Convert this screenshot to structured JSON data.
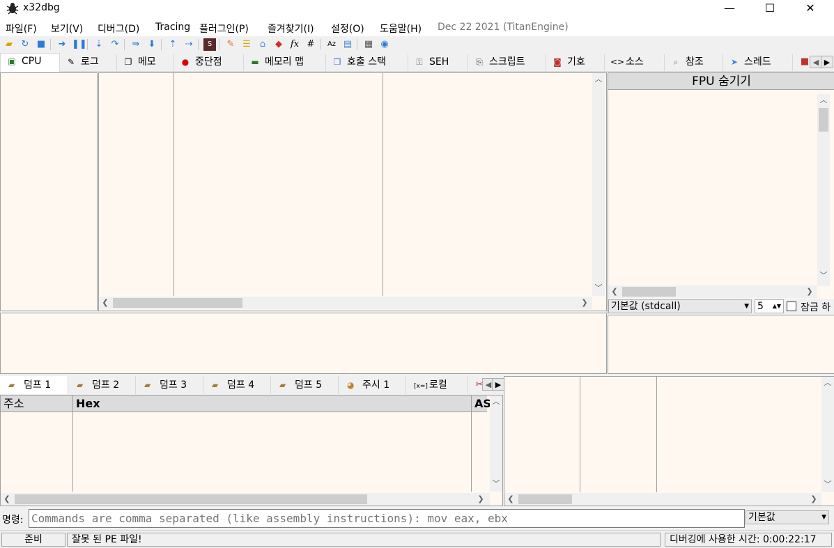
{
  "window": {
    "title": "x32dbg",
    "controls": {
      "minimize": "—",
      "maximize": "☐",
      "close": "✕"
    }
  },
  "menu": {
    "items": [
      "파일(F)",
      "보기(V)",
      "디버그(D)",
      "Tracing",
      "플러그인(P)",
      "즐겨찾기(I)",
      "설정(O)",
      "도움말(H)"
    ],
    "build_date": "Dec 22 2021 (TitanEngine)"
  },
  "toolbar": {
    "icons": [
      "open-icon",
      "restart-icon",
      "stop-icon",
      "run-icon",
      "pause-icon",
      "step-into-icon",
      "step-over-icon",
      "trace-into-icon",
      "trace-over-icon",
      "execute-till-return-icon",
      "run-to-user-code-icon",
      "scylla-icon",
      "patch-icon",
      "comment-icon",
      "label-icon",
      "bookmark-icon",
      "function-icon",
      "hash-icon",
      "strings-icon",
      "calculator-icon",
      "help-icon",
      "globe-icon"
    ]
  },
  "tabs": [
    {
      "label": "CPU",
      "icon": "cpu-icon"
    },
    {
      "label": "로그",
      "icon": "log-icon"
    },
    {
      "label": "메모",
      "icon": "notes-icon"
    },
    {
      "label": "중단점",
      "icon": "breakpoint-icon"
    },
    {
      "label": "메모리 맵",
      "icon": "memory-map-icon"
    },
    {
      "label": "호출 스택",
      "icon": "call-stack-icon"
    },
    {
      "label": "SEH",
      "icon": "seh-icon"
    },
    {
      "label": "스크립트",
      "icon": "script-icon"
    },
    {
      "label": "기호",
      "icon": "symbols-icon"
    },
    {
      "label": "소스",
      "icon": "source-icon"
    },
    {
      "label": "참조",
      "icon": "references-icon"
    },
    {
      "label": "스레드",
      "icon": "threads-icon"
    }
  ],
  "registers": {
    "header": "FPU 숨기기",
    "convention": "기본값 (stdcall)",
    "arg_count": "5",
    "lock_label": "잠금 하"
  },
  "dump_tabs": [
    {
      "label": "덤프 1",
      "icon": "dump-icon"
    },
    {
      "label": "덤프 2",
      "icon": "dump-icon"
    },
    {
      "label": "덤프 3",
      "icon": "dump-icon"
    },
    {
      "label": "덤프 4",
      "icon": "dump-icon"
    },
    {
      "label": "덤프 5",
      "icon": "dump-icon"
    },
    {
      "label": "주시 1",
      "icon": "watch-icon"
    },
    {
      "label": "로컬",
      "icon": "locals-icon"
    }
  ],
  "dump_columns": [
    "주소",
    "Hex",
    "AS"
  ],
  "command": {
    "label": "명령:",
    "placeholder": "Commands are comma separated (like assembly instructions): mov eax, ebx",
    "mode": "기본값"
  },
  "status": {
    "state": "준비",
    "message": "잘못 된 PE 파일!",
    "debug_time": "디버깅에 사용한 시간: 0:00:22:17"
  }
}
